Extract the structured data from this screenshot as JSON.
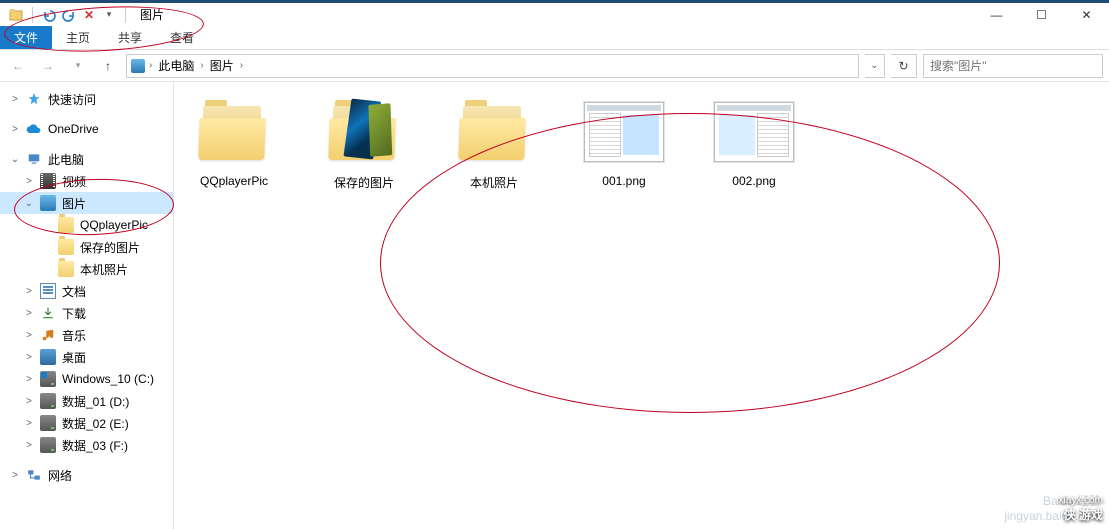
{
  "title": "图片",
  "window_controls": {
    "min": "—",
    "max": "☐",
    "close": "✕"
  },
  "ribbon": {
    "file": "文件",
    "home": "主页",
    "share": "共享",
    "view": "查看"
  },
  "nav_arrows": {
    "back": "←",
    "fwd": "→",
    "up": "↑"
  },
  "breadcrumb": [
    {
      "label": "此电脑",
      "icon": "pc"
    },
    {
      "label": "图片"
    }
  ],
  "search": {
    "placeholder": "搜索\"图片\""
  },
  "tree": [
    {
      "type": "item",
      "level": 0,
      "icon": "star",
      "label": "快速访问",
      "exp": ">"
    },
    {
      "type": "spacer"
    },
    {
      "type": "item",
      "level": 0,
      "icon": "onedrive",
      "label": "OneDrive",
      "exp": ">"
    },
    {
      "type": "spacer"
    },
    {
      "type": "item",
      "level": 0,
      "icon": "pc",
      "label": "此电脑",
      "exp": "⌄"
    },
    {
      "type": "item",
      "level": 1,
      "icon": "video",
      "label": "视频",
      "exp": ">"
    },
    {
      "type": "item",
      "level": 1,
      "icon": "pics",
      "label": "图片",
      "exp": "⌄",
      "selected": true
    },
    {
      "type": "item",
      "level": 2,
      "icon": "folder",
      "label": "QQplayerPic"
    },
    {
      "type": "item",
      "level": 2,
      "icon": "folder",
      "label": "保存的图片"
    },
    {
      "type": "item",
      "level": 2,
      "icon": "folder",
      "label": "本机照片"
    },
    {
      "type": "item",
      "level": 1,
      "icon": "doc",
      "label": "文档",
      "exp": ">"
    },
    {
      "type": "item",
      "level": 1,
      "icon": "download",
      "label": "下载",
      "exp": ">"
    },
    {
      "type": "item",
      "level": 1,
      "icon": "music",
      "label": "音乐",
      "exp": ">"
    },
    {
      "type": "item",
      "level": 1,
      "icon": "desktop",
      "label": "桌面",
      "exp": ">"
    },
    {
      "type": "item",
      "level": 1,
      "icon": "drive os",
      "label": "Windows_10 (C:)",
      "exp": ">"
    },
    {
      "type": "item",
      "level": 1,
      "icon": "drive",
      "label": "数据_01 (D:)",
      "exp": ">"
    },
    {
      "type": "item",
      "level": 1,
      "icon": "drive",
      "label": "数据_02 (E:)",
      "exp": ">"
    },
    {
      "type": "item",
      "level": 1,
      "icon": "drive",
      "label": "数据_03 (F:)",
      "exp": ">"
    },
    {
      "type": "spacer"
    },
    {
      "type": "item",
      "level": 0,
      "icon": "net",
      "label": "网络",
      "exp": ">"
    }
  ],
  "items": [
    {
      "kind": "folder",
      "label": "QQplayerPic"
    },
    {
      "kind": "folder-peacock",
      "label": "保存的图片"
    },
    {
      "kind": "folder",
      "label": "本机照片"
    },
    {
      "kind": "image",
      "variant": "1",
      "label": "001.png"
    },
    {
      "kind": "image",
      "variant": "2",
      "label": "002.png"
    }
  ],
  "watermark": {
    "line1": "Baidu 经验",
    "line2": "jingyan.baidu.com",
    "site": "xiayx.com",
    "brand": "侠 游戏"
  }
}
